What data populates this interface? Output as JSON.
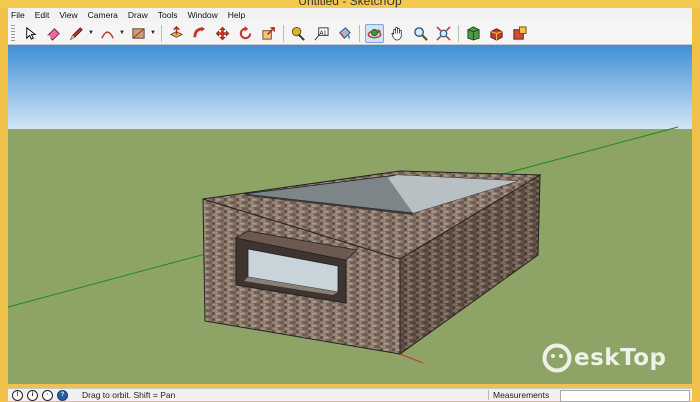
{
  "window": {
    "title": "Untitled - SketchUp"
  },
  "menu": {
    "items": [
      "File",
      "Edit",
      "View",
      "Camera",
      "Draw",
      "Tools",
      "Window",
      "Help"
    ]
  },
  "toolbar": {
    "tools": [
      {
        "icon": "select-arrow-icon"
      },
      {
        "icon": "eraser-icon"
      },
      {
        "icon": "pencil-line-icon"
      },
      {
        "icon": "arc-icon"
      },
      {
        "icon": "rectangle-shape-icon"
      },
      {
        "icon": "push-pull-icon"
      },
      {
        "icon": "follow-me-icon"
      },
      {
        "icon": "move-icon"
      },
      {
        "icon": "rotate-icon"
      },
      {
        "icon": "scale-icon"
      },
      {
        "icon": "tape-measure-icon"
      },
      {
        "icon": "text-label-icon"
      },
      {
        "icon": "paint-bucket-icon"
      },
      {
        "icon": "orbit-icon",
        "active": true
      },
      {
        "icon": "pan-hand-icon"
      },
      {
        "icon": "zoom-icon"
      },
      {
        "icon": "zoom-extents-icon"
      },
      {
        "icon": "warehouse-icon"
      },
      {
        "icon": "components-icon"
      },
      {
        "icon": "extension-icon"
      }
    ]
  },
  "status": {
    "text": "Drag to orbit.  Shift = Pan",
    "measurements_label": "Measurements",
    "measurements_value": ""
  },
  "watermark": {
    "text": "eskTop"
  },
  "colors": {
    "title_bar": "#f3c84e",
    "sky_top": "#3f8fd6",
    "sky_bottom": "#d2e6f5",
    "ground": "#8ea466",
    "active_tool": "#cfe3f7"
  }
}
